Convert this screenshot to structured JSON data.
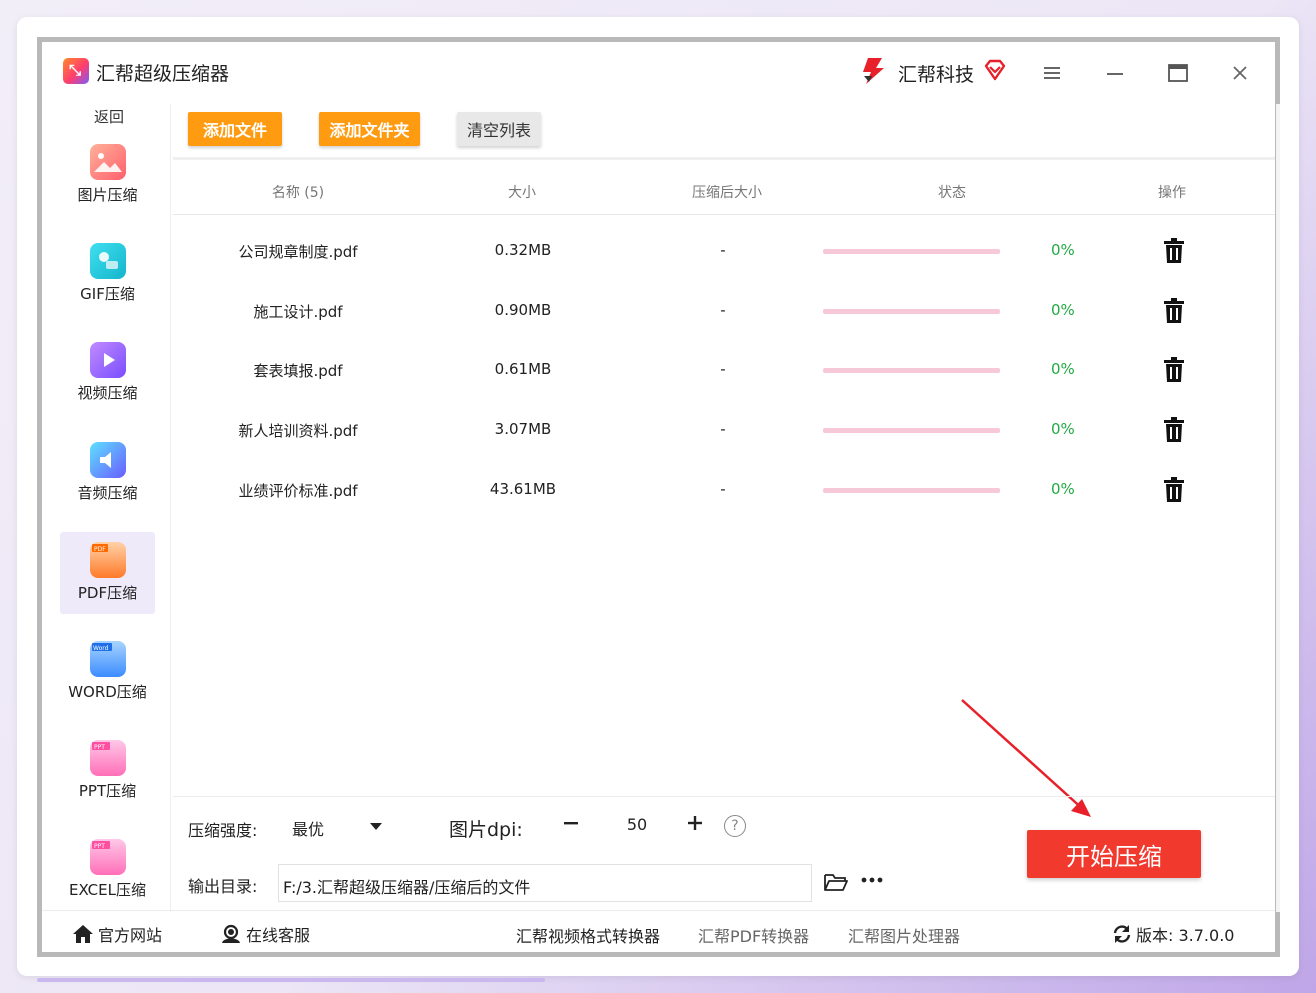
{
  "window": {
    "title": "汇帮超级压缩器",
    "brand_name": "汇帮科技"
  },
  "sidebar": {
    "back_label": "返回",
    "items": [
      {
        "label": "图片压缩",
        "icon": "image-icon",
        "color": "#ff6b6b"
      },
      {
        "label": "GIF压缩",
        "icon": "gif-icon",
        "color": "#1cc7d8"
      },
      {
        "label": "视频压缩",
        "icon": "video-icon",
        "color": "#9b6bff"
      },
      {
        "label": "音频压缩",
        "icon": "audio-icon",
        "color": "#4aa8ff"
      },
      {
        "label": "PDF压缩",
        "icon": "pdf-icon",
        "color": "#ff8a3d",
        "active": true
      },
      {
        "label": "WORD压缩",
        "icon": "word-icon",
        "color": "#3b8cff"
      },
      {
        "label": "PPT压缩",
        "icon": "ppt-icon",
        "color": "#ff6fb8"
      },
      {
        "label": "EXCEL压缩",
        "icon": "excel-icon",
        "color": "#ff6fb8"
      }
    ]
  },
  "toolbar": {
    "add_file": "添加文件",
    "add_folder": "添加文件夹",
    "clear_list": "清空列表"
  },
  "table": {
    "headers": [
      "名称 (5)",
      "大小",
      "压缩后大小",
      "状态",
      "操作"
    ],
    "rows": [
      {
        "name": "公司规章制度.pdf",
        "size": "0.32MB",
        "compressed": "-",
        "progress": "0%"
      },
      {
        "name": "施工设计.pdf",
        "size": "0.90MB",
        "compressed": "-",
        "progress": "0%"
      },
      {
        "name": "套表填报.pdf",
        "size": "0.61MB",
        "compressed": "-",
        "progress": "0%"
      },
      {
        "name": "新人培训资料.pdf",
        "size": "3.07MB",
        "compressed": "-",
        "progress": "0%"
      },
      {
        "name": "业绩评价标准.pdf",
        "size": "43.61MB",
        "compressed": "-",
        "progress": "0%"
      }
    ]
  },
  "settings": {
    "strength_label": "压缩强度:",
    "strength_value": "最优",
    "dpi_label": "图片dpi:",
    "dpi_value": "50",
    "output_label": "输出目录:",
    "output_path": "F:/3.汇帮超级压缩器/压缩后的文件"
  },
  "start_button": "开始压缩",
  "footer": {
    "website": "官方网站",
    "support": "在线客服",
    "link1": "汇帮视频格式转换器",
    "link2": "汇帮PDF转换器",
    "link3": "汇帮图片处理器",
    "version": "版本: 3.7.0.0"
  },
  "colors": {
    "accent_orange": "#ff9b10",
    "start_red": "#f2392e",
    "progress_pink": "#f7c9d8",
    "percent_green": "#22aa44"
  }
}
